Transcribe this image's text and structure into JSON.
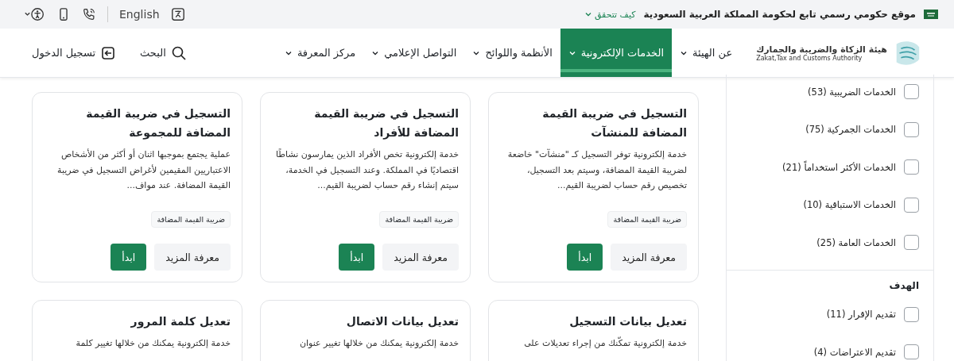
{
  "top_bar": {
    "notice": "موقع حكومي رسمي تابع لحكومة المملكة العربية السعودية",
    "verify_link": "كيف تتحقق",
    "language": "English"
  },
  "header": {
    "logo": {
      "name_ar": "هيئة الزكاة والضريبة والجمارك",
      "name_en": "Zakat,Tax and Customs Authority"
    },
    "nav": [
      {
        "label": "عن الهيئة",
        "selected": false
      },
      {
        "label": "الخدمات الإلكترونية",
        "selected": true
      },
      {
        "label": "الأنظمة واللوائح",
        "selected": false
      },
      {
        "label": "التواصل الإعلامي",
        "selected": false
      },
      {
        "label": "مركز المعرفة",
        "selected": false
      }
    ],
    "search": "البحث",
    "login": "تسجيل الدخول"
  },
  "filters": [
    {
      "items": [
        {
          "label": "الخدمات الضريبية (53)",
          "checked": false
        },
        {
          "label": "الخدمات الجمركية (75)",
          "checked": false
        },
        {
          "label": "الخدمات الأكثر استخداماً (21)",
          "checked": false
        },
        {
          "label": "الخدمات الاستباقية (10)",
          "checked": false
        },
        {
          "label": "الخدمات العامة (25)",
          "checked": false
        }
      ]
    },
    {
      "title": "الهدف",
      "items": [
        {
          "label": "تقديم الإقرار (11)",
          "checked": false
        },
        {
          "label": "تقديم الاعتراضات (4)",
          "checked": false
        }
      ]
    }
  ],
  "cards": [
    {
      "title": "التسجيل في ضريبة القيمة المضافة للمنشآت",
      "description": "خدمة إلكترونية توفر التسجيل كـ \"منشآت\" خاضعة لضريبة القيمة المضافة، وسيتم بعد التسجيل، تخصيص رقم حساب لضريبة القيم...",
      "tag": "ضريبة القيمة المضافة",
      "more": "معرفة المزيد",
      "start": "ابدأ"
    },
    {
      "title": "التسجيل في ضريبة القيمة المضافة للأفراد",
      "description": "خدمة إلكترونية تخص الأفراد الذين يمارسون نشاطًا اقتصاديًا في المملكة. وعند التسجيل في الخدمة، سيتم إنشاء رقم حساب لضريبة القيم...",
      "tag": "ضريبة القيمة المضافة",
      "more": "معرفة المزيد",
      "start": "ابدأ"
    },
    {
      "title": "التسجيل في ضريبة القيمة المضافة للمجموعة",
      "description": "عملية يجتمع بموجبها اثنان أو أكثر من الأشخاص الاعتباريين المقيمين لأغراض التسجيل في ضريبة القيمة المضافة. عند مواف...",
      "tag": "ضريبة القيمة المضافة",
      "more": "معرفة المزيد",
      "start": "ابدأ"
    },
    {
      "title": "تعديل بيانات التسجيل",
      "description": "خدمة إلكترونية تمكّنك من إجراء تعديلات على"
    },
    {
      "title": "تعديل بيانات الاتصال",
      "description": "خدمة إلكترونية يمكنك من خلالها تغيير عنوان"
    },
    {
      "title": "تعديل كلمة المرور",
      "description": "خدمة إلكترونية يمكنك من خلالها تغيير كلمة"
    }
  ]
}
